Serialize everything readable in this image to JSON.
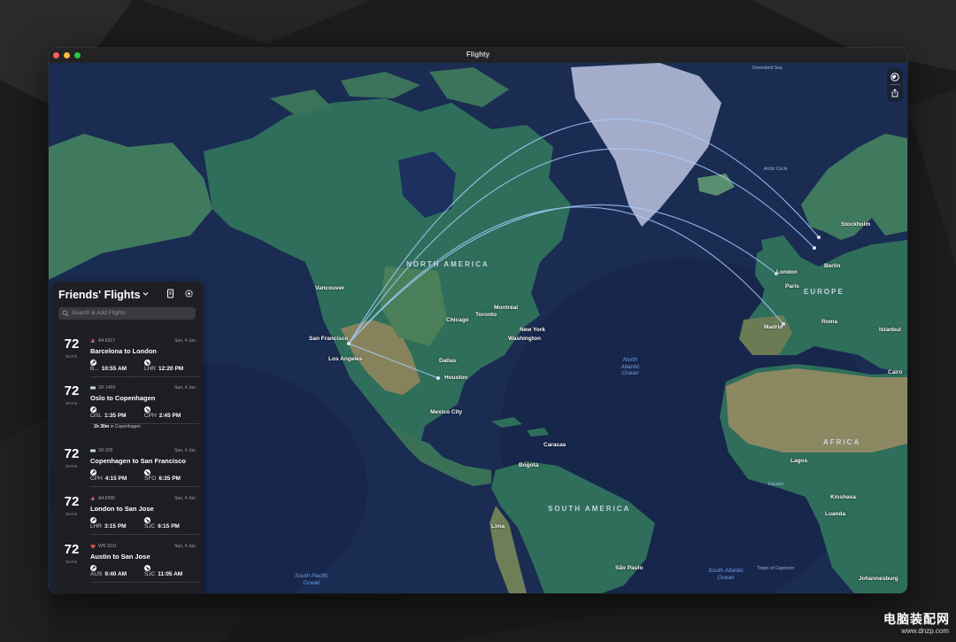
{
  "window": {
    "title": "Flighty"
  },
  "colors": {
    "ocean": "#172a4a",
    "land": "#2f6e5b",
    "land_dry": "#8c8862",
    "ice": "#a5afcd",
    "route": "#a9ccff",
    "sidebar": "#1e1e21",
    "close": "#ff5f57",
    "minimize": "#febc2e",
    "maximize": "#28c840"
  },
  "map_tools": [
    {
      "icon": "globe-icon"
    },
    {
      "icon": "share-icon"
    }
  ],
  "map_labels": {
    "regions": {
      "north_america": "NORTH AMERICA",
      "south_america": "SOUTH AMERICA",
      "europe": "EUROPE",
      "africa": "AFRICA"
    },
    "oceans": {
      "north_atlantic": "North Atlantic Ocean",
      "south_pacific": "South Pacific Ocean",
      "south_atlantic": "South Atlantic Ocean"
    },
    "cities": {
      "vancouver": "Vancouver",
      "san_francisco": "San Francisco",
      "los_angeles": "Los Angeles",
      "dallas": "Dallas",
      "houston": "Houston",
      "mexico_city": "Mexico City",
      "chicago": "Chicago",
      "toronto": "Toronto",
      "montreal": "Montréal",
      "new_york": "New York",
      "washington": "Washington",
      "caracas": "Caracas",
      "bogota": "Bogotá",
      "lima": "Lima",
      "sao_paulo": "São Paulo",
      "london": "London",
      "paris": "Paris",
      "madrid": "Madrid",
      "roma": "Roma",
      "berlin": "Berlin",
      "stockholm": "Stockholm",
      "istanbul": "Istanbul",
      "cairo": "Cairo",
      "lagos": "Lagos",
      "kinshasa": "Kinshasa",
      "luanda": "Luanda",
      "johannesburg": "Johannesburg"
    },
    "minor": {
      "greenland_sea": "Greenland Sea",
      "arctic_circle": "Arctic Circle",
      "equator": "Equator",
      "tropic_capricorn": "Tropic of Capricorn"
    }
  },
  "sidebar": {
    "title": "Friends' Flights",
    "search_placeholder": "Search & Add Flights",
    "flights": [
      {
        "days": "72",
        "days_label": "DAYS",
        "airline_icon": "aa-logo-icon",
        "code": "AA 6917",
        "date": "Sun, 4 Jun",
        "route": "Barcelona to London",
        "dep_iata": "B...",
        "dep_time": "10:55 AM",
        "arr_iata": "LHR",
        "arr_time": "12:20 PM"
      },
      {
        "days": "72",
        "days_label": "DAYS",
        "airline_icon": "sas-logo-icon",
        "code": "SK 1469",
        "date": "Sun, 4 Jun",
        "route": "Oslo to Copenhagen",
        "dep_iata": "OSL",
        "dep_time": "1:35 PM",
        "arr_iata": "CPH",
        "arr_time": "2:45 PM"
      },
      {
        "days": "72",
        "days_label": "DAYS",
        "airline_icon": "sas-logo-icon",
        "code": "SK 935",
        "date": "Sun, 4 Jun",
        "route": "Copenhagen to San Francisco",
        "dep_iata": "CPH",
        "dep_time": "4:15 PM",
        "arr_iata": "SFO",
        "arr_time": "6:35 PM"
      },
      {
        "days": "72",
        "days_label": "DAYS",
        "airline_icon": "aa-logo-icon",
        "code": "AA 6990",
        "date": "Sun, 4 Jun",
        "route": "London to San Jose",
        "dep_iata": "LHR",
        "dep_time": "3:15 PM",
        "arr_iata": "SJC",
        "arr_time": "6:15 PM"
      },
      {
        "days": "72",
        "days_label": "DAYS",
        "airline_icon": "southwest-logo-icon",
        "code": "WN 3231",
        "date": "Sun, 4 Jun",
        "route": "Austin to San Jose",
        "dep_iata": "AUS",
        "dep_time": "9:40 AM",
        "arr_iata": "SJC",
        "arr_time": "11:05 AM"
      }
    ],
    "layover": {
      "duration": "1h 30m",
      "text": "in Copenhagen"
    }
  },
  "watermark": {
    "title": "电脑装配网",
    "url": "www.dnzp.com"
  }
}
